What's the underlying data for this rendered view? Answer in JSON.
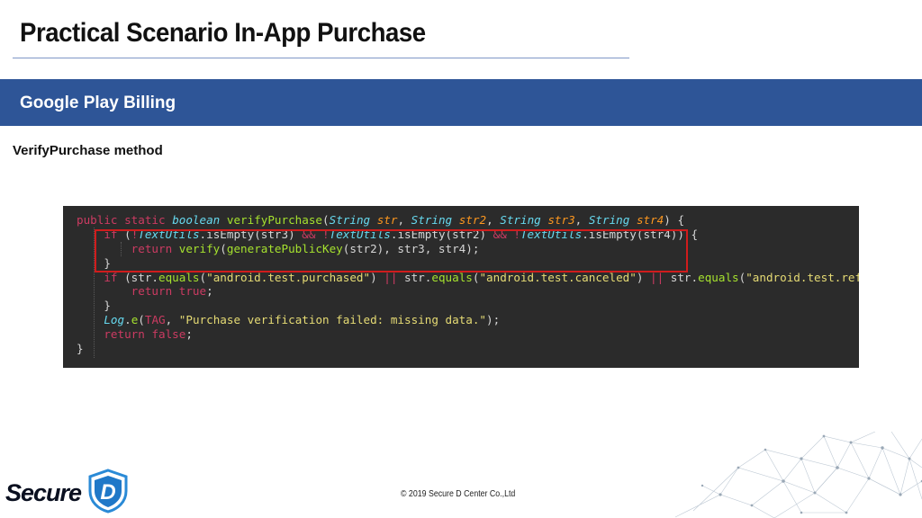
{
  "slide": {
    "title": "Practical Scenario In-App Purchase",
    "section": "Google Play Billing",
    "subtitle": "VerifyPurchase method",
    "footer": "© 2019 Secure D Center Co.,Ltd"
  },
  "logo": {
    "text": "Secure",
    "shield_letter": "D",
    "shield_icon": "shield-icon"
  },
  "code": {
    "lines": [
      "public static boolean verifyPurchase(String str, String str2, String str3, String str4) {",
      "    if (!TextUtils.isEmpty(str3) && !TextUtils.isEmpty(str2) && !TextUtils.isEmpty(str4)) {",
      "        return verify(generatePublicKey(str2), str3, str4);",
      "    }",
      "    if (str.equals(\"android.test.purchased\") || str.equals(\"android.test.canceled\") || str.equals(\"android.test.refunde",
      "        return true;",
      "    }",
      "    Log.e(TAG, \"Purchase verification failed: missing data.\");",
      "    return false;",
      "}"
    ]
  },
  "colors": {
    "band": "#2e5597",
    "code_background": "#2b2b2b",
    "highlight": "#d01c1c"
  }
}
